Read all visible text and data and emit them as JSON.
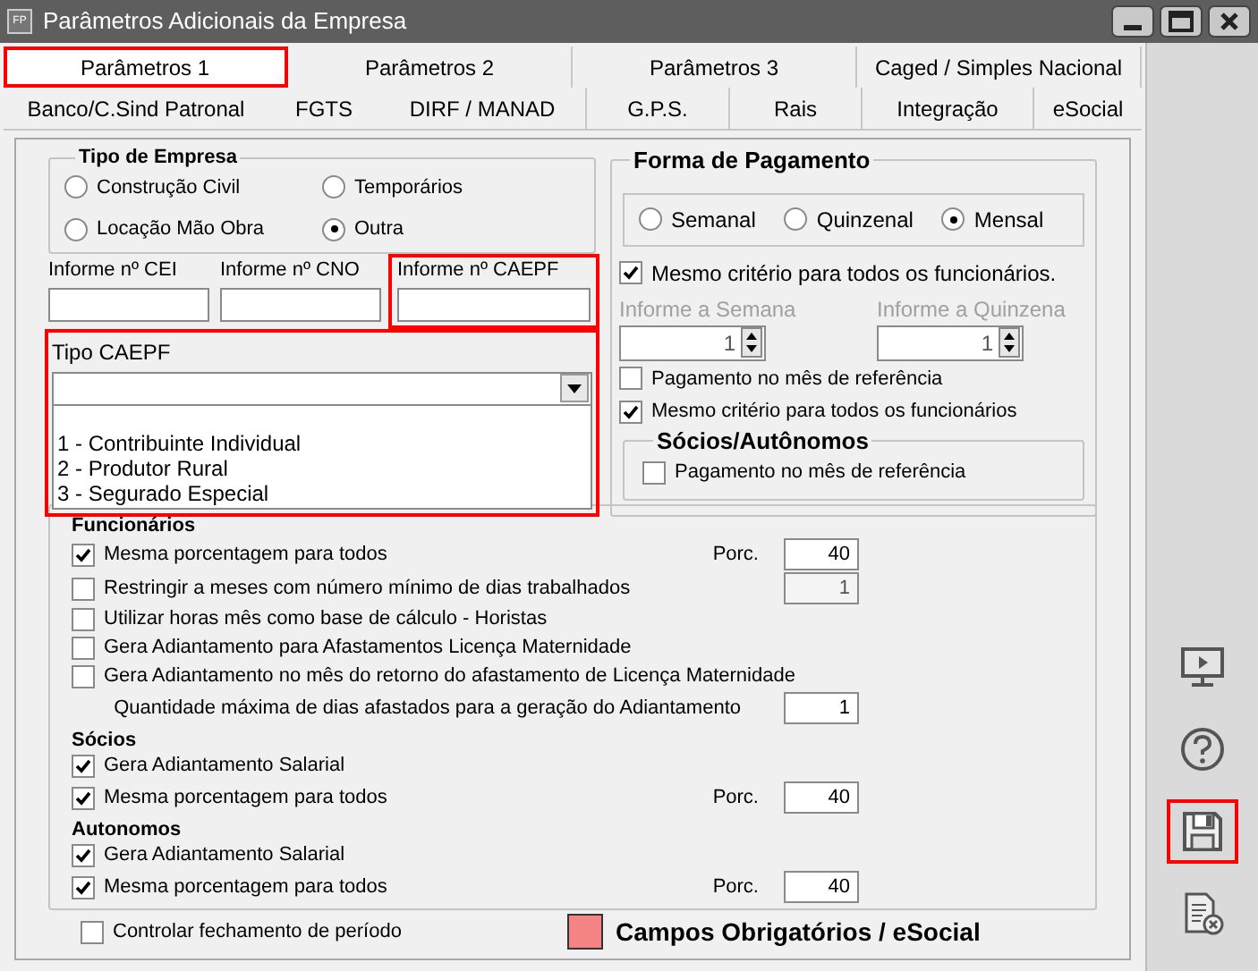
{
  "window": {
    "title": "Parâmetros Adicionais da Empresa",
    "app_badge": "FP"
  },
  "tabs_row1": [
    {
      "label": "Parâmetros 1",
      "selected": true,
      "highlighted": true
    },
    {
      "label": "Parâmetros 2",
      "selected": false,
      "highlighted": false
    },
    {
      "label": "Parâmetros 3",
      "selected": false,
      "highlighted": false
    },
    {
      "label": "Caged / Simples Nacional",
      "selected": false,
      "highlighted": false
    }
  ],
  "tabs_row2": [
    {
      "label": "Banco/C.Sind Patronal",
      "selected": false
    },
    {
      "label": "FGTS",
      "selected": false
    },
    {
      "label": "DIRF / MANAD",
      "selected": false
    },
    {
      "label": "G.P.S.",
      "selected": false
    },
    {
      "label": "Rais",
      "selected": false
    },
    {
      "label": "Integração",
      "selected": false
    },
    {
      "label": "eSocial",
      "selected": false
    }
  ],
  "tipo_empresa": {
    "title": "Tipo de Empresa",
    "options": [
      {
        "label": "Construção Civil",
        "selected": false
      },
      {
        "label": "Temporários",
        "selected": false
      },
      {
        "label": "Locação Mão Obra",
        "selected": false
      },
      {
        "label": "Outra",
        "selected": true
      }
    ]
  },
  "fields": [
    {
      "label": "Informe nº CEI",
      "highlighted": false
    },
    {
      "label": "Informe nº CNO",
      "highlighted": false
    },
    {
      "label": "Informe nº CAEPF",
      "highlighted": true
    }
  ],
  "tipo_caepf": {
    "label": "Tipo CAEPF",
    "highlighted": true,
    "options": [
      "1 - Contribuinte Individual",
      "2 - Produtor Rural",
      "3 - Segurado Especial"
    ]
  },
  "forma_pagamento": {
    "title": "Forma de Pagamento",
    "options": [
      {
        "label": "Semanal",
        "selected": false
      },
      {
        "label": "Quinzenal",
        "selected": false
      },
      {
        "label": "Mensal",
        "selected": true
      }
    ],
    "same_criteria": {
      "label": "Mesmo critério para todos os funcionários.",
      "checked": true
    },
    "spins": [
      {
        "label": "Informe a Semana",
        "value": "1",
        "disabled": true
      },
      {
        "label": "Informe a Quinzena",
        "value": "1",
        "disabled": true
      }
    ],
    "checks": [
      {
        "label": "Pagamento no mês de referência",
        "checked": false
      },
      {
        "label": "Mesmo critério para todos os funcionários",
        "checked": true
      }
    ],
    "socios": {
      "title": "Sócios/Autônomos",
      "checks": [
        {
          "label": "Pagamento no mês de referência",
          "checked": false
        }
      ]
    }
  },
  "adiantamento": {
    "sections": [
      {
        "title": "Funcionários",
        "rows": [
          {
            "kind": "check",
            "label": "Mesma porcentagem para todos",
            "checked": true,
            "porc_label": "Porc.",
            "value": "40",
            "disabled": false
          },
          {
            "kind": "check",
            "label": "Restringir a meses com número mínimo de dias trabalhados",
            "checked": false,
            "value": "1",
            "disabled": true
          },
          {
            "kind": "check",
            "label": "Utilizar horas mês como base de cálculo - Horistas",
            "checked": false
          },
          {
            "kind": "check",
            "label": "Gera Adiantamento para Afastamentos Licença Maternidade",
            "checked": false
          },
          {
            "kind": "check",
            "label": "Gera Adiantamento no mês do retorno do afastamento de Licença Maternidade",
            "checked": false
          },
          {
            "kind": "quantity",
            "label": "Quantidade máxima de dias afastados para a geração do Adiantamento",
            "value": "1",
            "disabled": false
          }
        ]
      },
      {
        "title": "Sócios",
        "rows": [
          {
            "kind": "check",
            "label": "Gera Adiantamento Salarial",
            "checked": true
          },
          {
            "kind": "check",
            "label": "Mesma porcentagem para todos",
            "checked": true,
            "porc_label": "Porc.",
            "value": "40",
            "disabled": false
          }
        ]
      },
      {
        "title": "Autonomos",
        "rows": [
          {
            "kind": "check",
            "label": "Gera Adiantamento Salarial",
            "checked": true
          },
          {
            "kind": "check",
            "label": "Mesma porcentagem para todos",
            "checked": true,
            "porc_label": "Porc.",
            "value": "40",
            "disabled": false
          }
        ]
      }
    ]
  },
  "footer": {
    "check": {
      "label": "Controlar fechamento de período",
      "checked": false
    },
    "legend": {
      "label": "Campos Obrigatórios / eSocial",
      "color": "#f48484"
    }
  },
  "sidebar_buttons": [
    {
      "kind": "monitor",
      "highlighted": false
    },
    {
      "kind": "help",
      "highlighted": false
    },
    {
      "kind": "save",
      "highlighted": true
    },
    {
      "kind": "cancel-document",
      "highlighted": false
    }
  ]
}
